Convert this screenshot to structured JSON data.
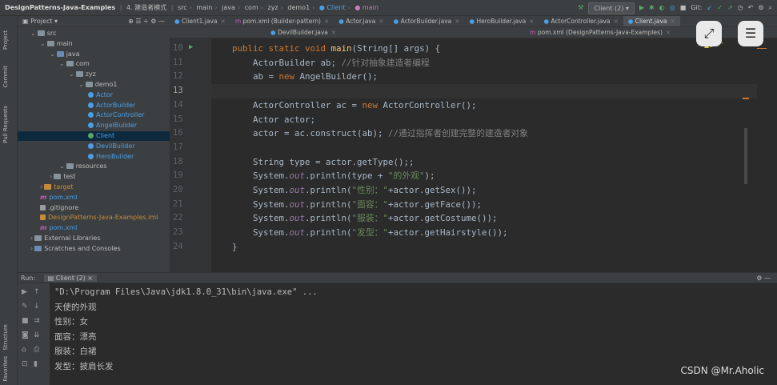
{
  "titlebar": {
    "project": "DesignPatterns-Java-Examples",
    "module": "4. 建造者模式",
    "crumbs": [
      "src",
      "main",
      "java",
      "com",
      "zyz",
      "demo1"
    ],
    "class_crumb": "Client",
    "method_crumb": "main",
    "run_config": "Client (2)",
    "git_label": "Git:"
  },
  "project_panel": {
    "header": "Project",
    "tree": [
      {
        "label": "src",
        "depth": 1,
        "kind": "folder"
      },
      {
        "label": "main",
        "depth": 2,
        "kind": "folder"
      },
      {
        "label": "java",
        "depth": 3,
        "kind": "folder-blue"
      },
      {
        "label": "com",
        "depth": 4,
        "kind": "package"
      },
      {
        "label": "zyz",
        "depth": 5,
        "kind": "package"
      },
      {
        "label": "demo1",
        "depth": 6,
        "kind": "package"
      },
      {
        "label": "Actor",
        "depth": 7,
        "kind": "class"
      },
      {
        "label": "ActorBuilder",
        "depth": 7,
        "kind": "class"
      },
      {
        "label": "ActorController",
        "depth": 7,
        "kind": "class"
      },
      {
        "label": "AngelBuilder",
        "depth": 7,
        "kind": "class"
      },
      {
        "label": "Client",
        "depth": 7,
        "kind": "class-selected"
      },
      {
        "label": "DevilBuilder",
        "depth": 7,
        "kind": "class"
      },
      {
        "label": "HeroBuilder",
        "depth": 7,
        "kind": "class"
      },
      {
        "label": "resources",
        "depth": 4,
        "kind": "folder"
      },
      {
        "label": "test",
        "depth": 3,
        "kind": "folder"
      },
      {
        "label": "target",
        "depth": 2,
        "kind": "folder-orange"
      },
      {
        "label": "pom.xml",
        "depth": 2,
        "kind": "maven"
      },
      {
        "label": ".gitignore",
        "depth": 2,
        "kind": "file"
      },
      {
        "label": "DesignPatterns-Java-Examples.iml",
        "depth": 2,
        "kind": "iml"
      },
      {
        "label": "pom.xml",
        "depth": 2,
        "kind": "maven"
      },
      {
        "label": "External Libraries",
        "depth": 1,
        "kind": "lib"
      },
      {
        "label": "Scratches and Consoles",
        "depth": 1,
        "kind": "scratch"
      }
    ]
  },
  "tabs_row1": [
    "Client1.java",
    "pom.xml (Builder-pattern)",
    "Actor.java",
    "ActorBuilder.java",
    "HeroBuilder.java",
    "ActorController.java",
    "Client.java"
  ],
  "tabs_row2": [
    "DevilBuilder.java",
    "pom.xml (DesignPatterns-Java-Examples)"
  ],
  "editor": {
    "warning_count": "▲3",
    "lines": [
      {
        "num": "10",
        "html": "    <span class='kw'>public static void</span> <span class='fn'>main</span>(String[] args) {"
      },
      {
        "num": "11",
        "html": "        ActorBuilder ab; <span class='cm'>//针对抽象建造者编程</span>"
      },
      {
        "num": "12",
        "html": "        ab = <span class='kw'>new</span> AngelBuilder();"
      },
      {
        "num": "13",
        "html": ""
      },
      {
        "num": "14",
        "html": "        ActorController ac = <span class='kw'>new</span> ActorController();"
      },
      {
        "num": "15",
        "html": "        Actor actor;"
      },
      {
        "num": "16",
        "html": "        actor = ac.construct(ab); <span class='cm'>//通过指挥者创建完整的建造者对象</span>"
      },
      {
        "num": "17",
        "html": ""
      },
      {
        "num": "18",
        "html": "        String type = actor.getType();;"
      },
      {
        "num": "19",
        "html": "        System.<span class='it'>out</span>.println(type + <span class='str'>\"的外观\"</span>);"
      },
      {
        "num": "20",
        "html": "        System.<span class='it'>out</span>.println(<span class='str'>\"性别：\"</span>+actor.getSex());"
      },
      {
        "num": "21",
        "html": "        System.<span class='it'>out</span>.println(<span class='str'>\"面容：\"</span>+actor.getFace());"
      },
      {
        "num": "22",
        "html": "        System.<span class='it'>out</span>.println(<span class='str'>\"服装：\"</span>+actor.getCostume());"
      },
      {
        "num": "23",
        "html": "        System.<span class='it'>out</span>.println(<span class='str'>\"发型：\"</span>+actor.getHairstyle());"
      },
      {
        "num": "24",
        "html": "    }"
      }
    ]
  },
  "run_panel": {
    "label": "Run:",
    "tab": "Client (2)",
    "output": [
      "\"D:\\Program Files\\Java\\jdk1.8.0_31\\bin\\java.exe\" ...",
      "天使的外观",
      "性别：女",
      "面容：漂亮",
      "服装：白裙",
      "发型：披肩长发"
    ]
  },
  "sidebar_labels": [
    "Project",
    "Commit",
    "Pull Requests",
    "Structure",
    "Favorites"
  ],
  "watermark": "CSDN @Mr.Aholic"
}
